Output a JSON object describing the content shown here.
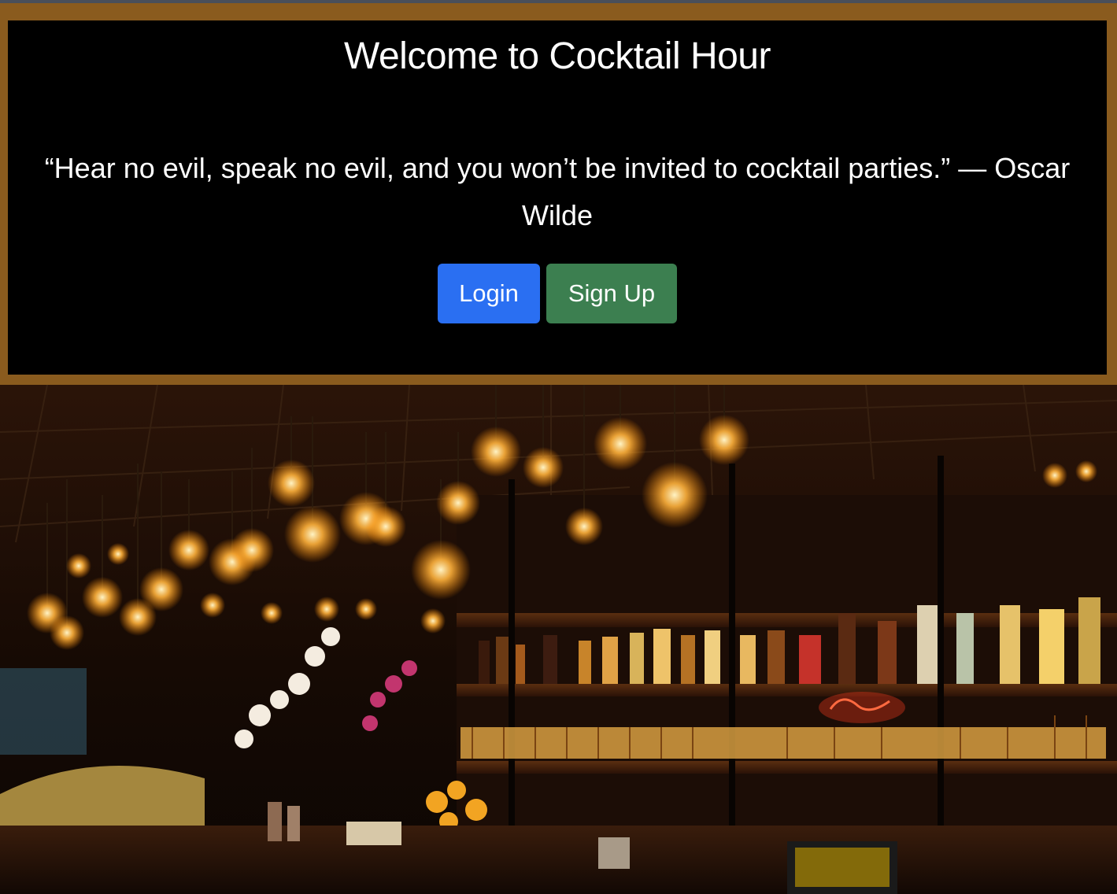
{
  "hero": {
    "title": "Welcome to Cocktail Hour",
    "quote": "“Hear no evil, speak no evil, and you won’t be invited to cocktail parties.” — Oscar Wilde",
    "login_label": "Login",
    "signup_label": "Sign Up"
  },
  "colors": {
    "frame": "#8a5b1e",
    "card": "#000000",
    "login": "#2a6ff2",
    "signup": "#3c7f50"
  },
  "image": {
    "subject": "bar-interior-photo"
  }
}
